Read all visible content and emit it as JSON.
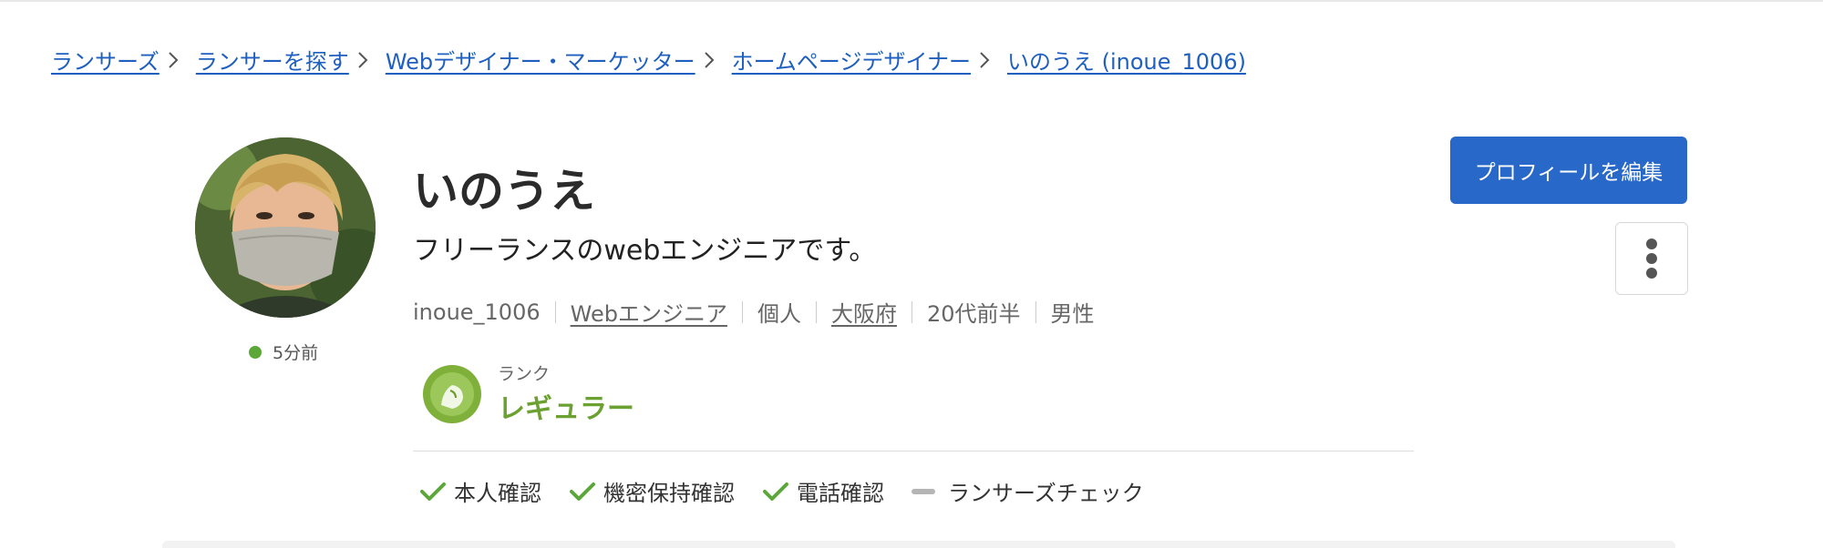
{
  "breadcrumb": [
    {
      "label": "ランサーズ"
    },
    {
      "label": "ランサーを探す"
    },
    {
      "label": "Webデザイナー・マーケッター"
    },
    {
      "label": "ホームページデザイナー"
    },
    {
      "label": "いのうえ (inoue_1006)"
    }
  ],
  "profile": {
    "name": "いのうえ",
    "tagline": "フリーランスのwebエンジニアです。",
    "last_seen": "5分前",
    "meta": {
      "username": "inoue_1006",
      "job": "Webエンジニア",
      "type": "個人",
      "location": "大阪府",
      "age": "20代前半",
      "gender": "男性"
    },
    "rank": {
      "label": "ランク",
      "value": "レギュラー"
    }
  },
  "verifications": [
    {
      "label": "本人確認",
      "verified": true
    },
    {
      "label": "機密保持確認",
      "verified": true
    },
    {
      "label": "電話確認",
      "verified": true
    },
    {
      "label": "ランサーズチェック",
      "verified": false
    }
  ],
  "actions": {
    "edit_label": "プロフィールを編集"
  },
  "colors": {
    "link": "#1f5fbf",
    "primary_button": "#2868c9",
    "online": "#5ba73a",
    "rank": "#6aa130",
    "check": "#5ba73a"
  },
  "icons": {
    "breadcrumb_separator": "chevron-right-icon",
    "more": "more-vertical-icon",
    "verified": "check-icon",
    "unverified": "dash-icon",
    "rank": "rank-badge-icon"
  }
}
